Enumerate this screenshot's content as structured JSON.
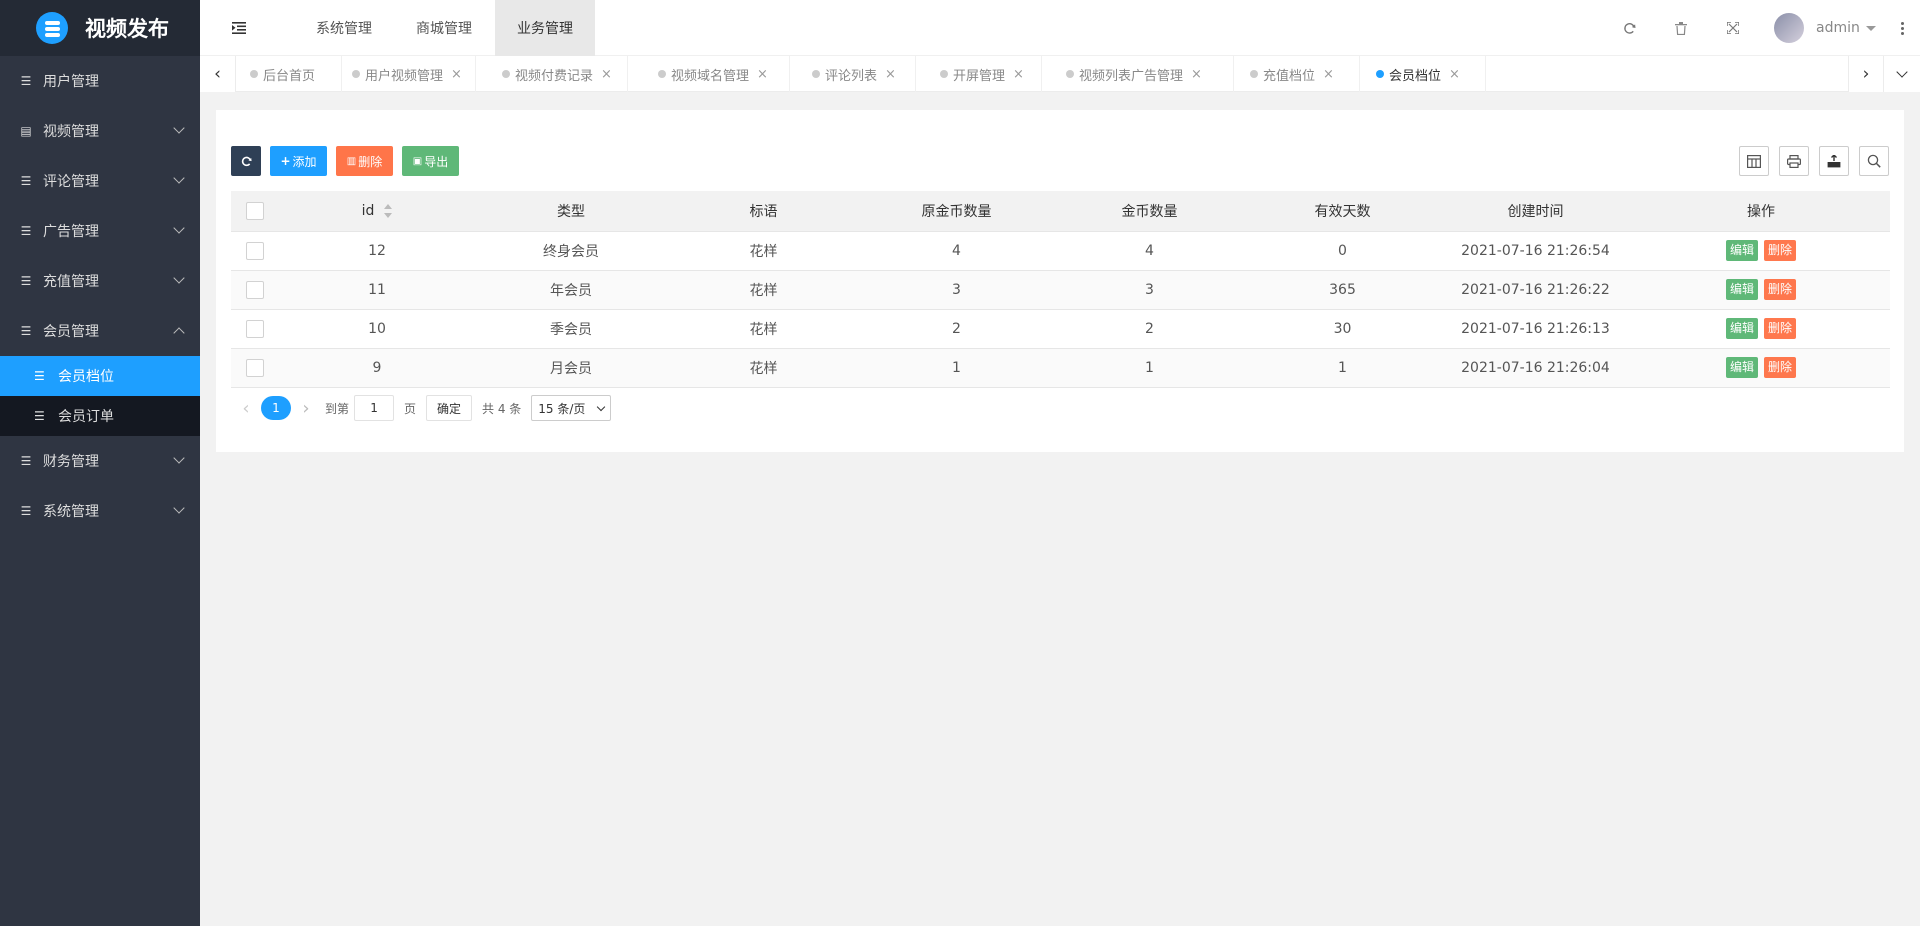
{
  "app": {
    "title": "视频发布"
  },
  "sidebar": {
    "items": [
      {
        "label": "用户管理"
      },
      {
        "label": "视频管理"
      },
      {
        "label": "评论管理"
      },
      {
        "label": "广告管理"
      },
      {
        "label": "充值管理"
      },
      {
        "label": "会员管理"
      },
      {
        "label": "财务管理"
      },
      {
        "label": "系统管理"
      }
    ],
    "sub_items": [
      {
        "label": "会员档位",
        "active": true
      },
      {
        "label": "会员订单"
      }
    ]
  },
  "topbar": {
    "menu": [
      {
        "label": "系统管理"
      },
      {
        "label": "商城管理"
      },
      {
        "label": "业务管理",
        "active": true
      }
    ],
    "user": "admin"
  },
  "tabs": [
    {
      "label": "后台首页"
    },
    {
      "label": "用户视频管理"
    },
    {
      "label": "视频付费记录"
    },
    {
      "label": "视频域名管理"
    },
    {
      "label": "评论列表"
    },
    {
      "label": "开屏管理"
    },
    {
      "label": "视频列表广告管理"
    },
    {
      "label": "充值档位"
    },
    {
      "label": "会员档位",
      "active": true
    }
  ],
  "toolbar": {
    "add": "添加",
    "delete": "删除",
    "export": "导出"
  },
  "table": {
    "columns": [
      "id",
      "类型",
      "标语",
      "原金币数量",
      "金币数量",
      "有效天数",
      "创建时间",
      "操作"
    ],
    "rows": [
      [
        "12",
        "终身会员",
        "花样",
        "4",
        "4",
        "0",
        "2021-07-16 21:26:54"
      ],
      [
        "11",
        "年会员",
        "花样",
        "3",
        "3",
        "365",
        "2021-07-16 21:26:22"
      ],
      [
        "10",
        "季会员",
        "花样",
        "2",
        "2",
        "30",
        "2021-07-16 21:26:13"
      ],
      [
        "9",
        "月会员",
        "花样",
        "1",
        "1",
        "1",
        "2021-07-16 21:26:04"
      ]
    ],
    "edit_label": "编辑",
    "delete_label": "删除"
  },
  "pager": {
    "current": "1",
    "goto_label": "到第",
    "page_value": "1",
    "page_label": "页",
    "confirm": "确定",
    "total": "共 4 条",
    "per_page": "15 条/页"
  },
  "colors": {
    "sidebar": "#2f3542",
    "accent": "#1e9fff",
    "add": "#1e9fff",
    "delete": "#ff5722",
    "export": "#5fb878",
    "refresh": "#2f4056"
  }
}
